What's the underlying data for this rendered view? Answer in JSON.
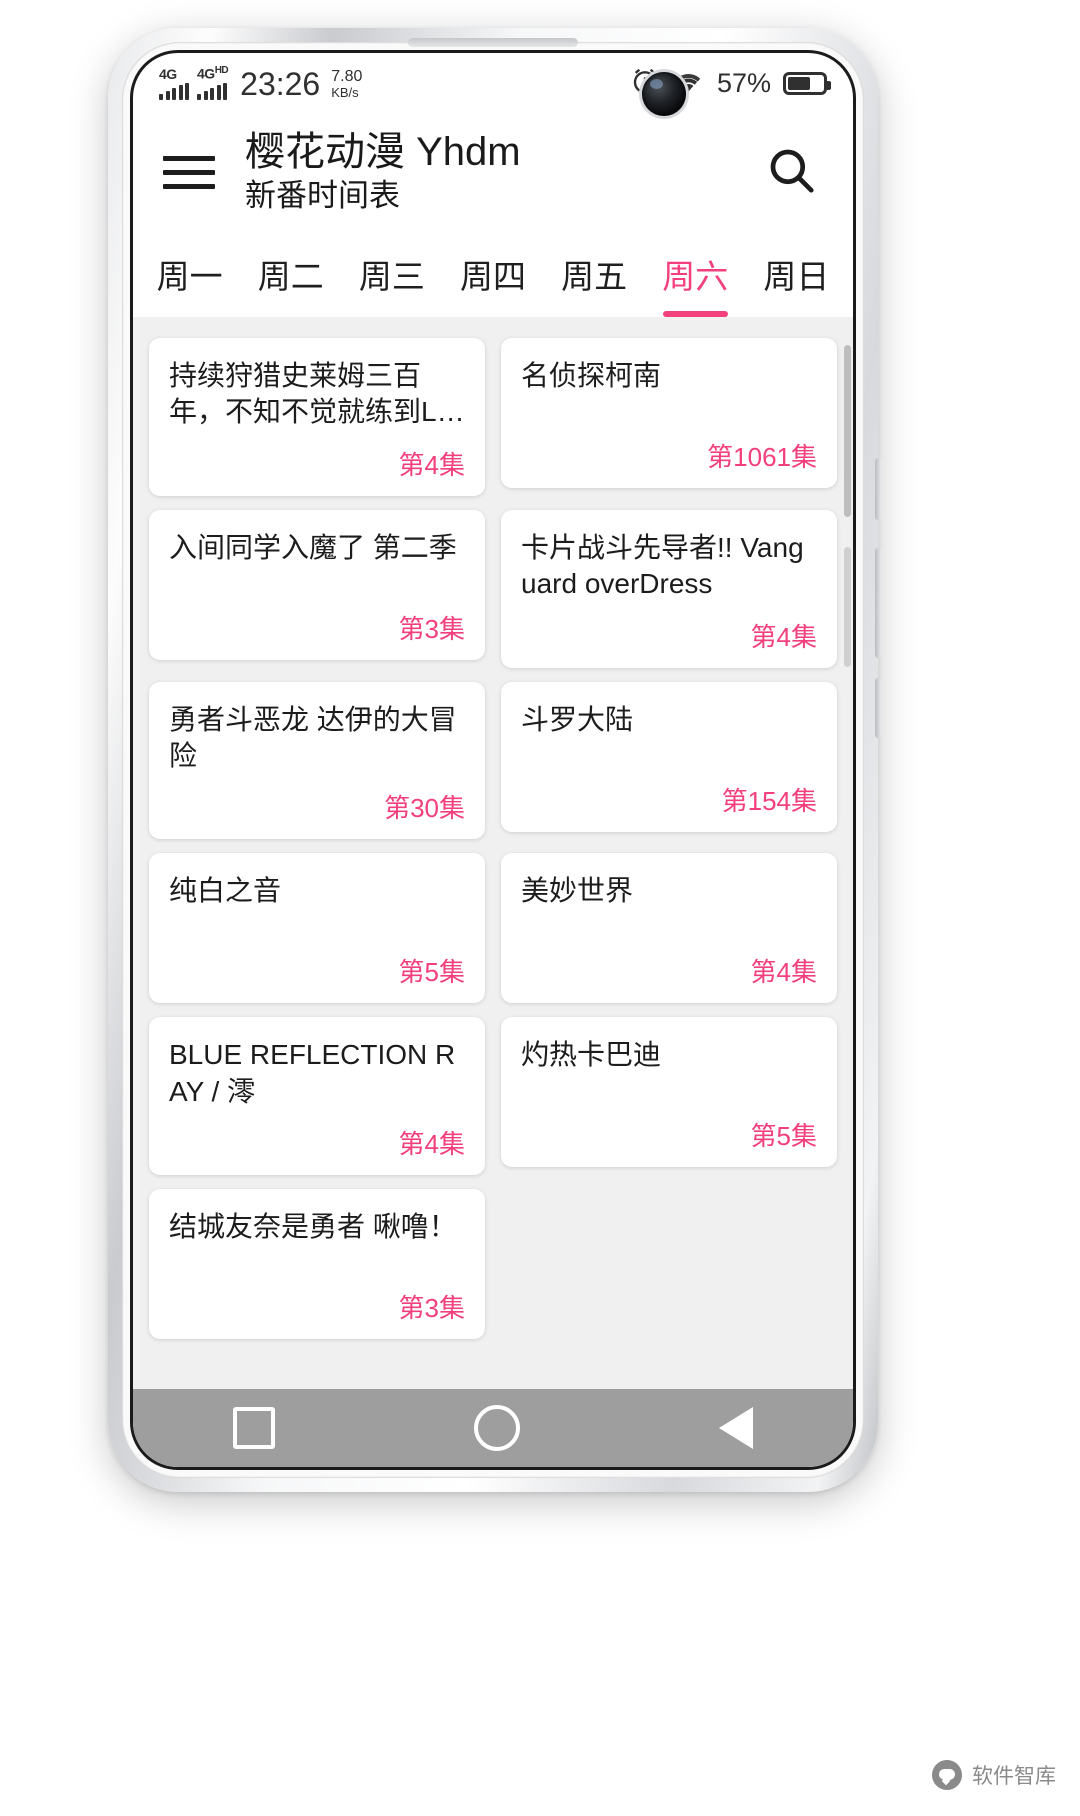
{
  "statusbar": {
    "network_1": "4G",
    "network_2": "4G",
    "network_2_sup": "HD",
    "time": "23:26",
    "speed_value": "7.80",
    "speed_unit": "KB/s",
    "alarm_icon": "alarm-clock-icon",
    "wifi_icon": "wifi-icon",
    "battery_percent": "57%",
    "battery_level": 57
  },
  "appbar": {
    "menu_icon": "hamburger-menu-icon",
    "title": "樱花动漫 Yhdm",
    "subtitle": "新番时间表",
    "search_icon": "search-icon"
  },
  "tabs": [
    {
      "label": "周一",
      "active": false
    },
    {
      "label": "周二",
      "active": false
    },
    {
      "label": "周三",
      "active": false
    },
    {
      "label": "周四",
      "active": false
    },
    {
      "label": "周五",
      "active": false
    },
    {
      "label": "周六",
      "active": true
    },
    {
      "label": "周日",
      "active": false
    }
  ],
  "accent_color": "#f2407d",
  "cards": [
    {
      "title": "持续狩猎史莱姆三百年，不知不觉就练到L…",
      "episode": "第4集"
    },
    {
      "title": "名侦探柯南",
      "episode": "第1061集"
    },
    {
      "title": "入间同学入魔了 第二季",
      "episode": "第3集"
    },
    {
      "title": "卡片战斗先导者!! Vanguard overDress",
      "episode": "第4集"
    },
    {
      "title": "勇者斗恶龙 达伊的大冒险",
      "episode": "第30集"
    },
    {
      "title": "斗罗大陆",
      "episode": "第154集"
    },
    {
      "title": "纯白之音",
      "episode": "第5集"
    },
    {
      "title": "美妙世界",
      "episode": "第4集"
    },
    {
      "title": "BLUE REFLECTION RAY / 澪",
      "episode": "第4集"
    },
    {
      "title": "灼热卡巴迪",
      "episode": "第5集"
    },
    {
      "title": "结城友奈是勇者 啾噜！",
      "episode": "第3集"
    },
    {
      "title": "",
      "episode": ""
    }
  ],
  "navbar": {
    "recents_icon": "square-recents-icon",
    "home_icon": "circle-home-icon",
    "back_icon": "triangle-back-icon"
  },
  "watermark": {
    "logo_icon": "wechat-logo-icon",
    "text": "软件智库"
  }
}
